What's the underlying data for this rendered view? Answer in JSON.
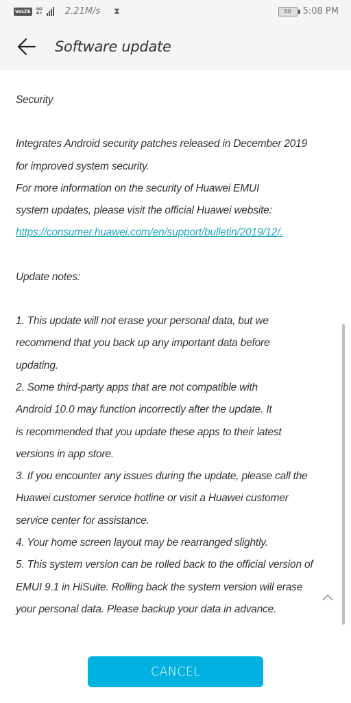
{
  "status_bar": {
    "volte": "VoLTE",
    "network_type": "4G",
    "network_sub": "4+",
    "speed": "2.21M/s",
    "battery": "50",
    "time": "5:08 PM",
    "icons": [
      "volte-icon",
      "signal-icon",
      "hourglass-icon",
      "battery-icon"
    ]
  },
  "app_bar": {
    "back_icon": "arrow-left-icon",
    "title": "Software update"
  },
  "content": {
    "security_heading": "Security",
    "security_lines": [
      "Integrates Android security patches released in December 2019",
      "for improved system security.",
      "For more information on the security of Huawei EMUI",
      "system updates, please visit the official Huawei website:"
    ],
    "security_link": "https://consumer.huawei.com/en/support/bulletin/2019/12/.",
    "notes_heading": "Update notes:",
    "notes_lines": [
      "1. This update will not erase your personal data, but we",
      "recommend that you back up any important data before",
      "updating.",
      "2. Some third-party apps that are not compatible with",
      "Android 10.0 may function incorrectly after the update. It",
      "is recommended that you update these apps to their latest",
      "versions in app store.",
      "3. If you encounter any issues during the update, please call the",
      "Huawei customer service hotline or visit a Huawei customer",
      "service center for assistance.",
      "4. Your home screen layout may be rearranged slightly.",
      "5. This system version can be rolled back to the official version of",
      "EMUI 9.1 in HiSuite. Rolling back the system version will erase",
      "your personal data. Please backup your data in advance."
    ],
    "collapse_icon": "chevron-up-icon"
  },
  "footer": {
    "cancel_label": "CANCEL",
    "accent_color": "#00b1e2",
    "link_color": "#26a7c1"
  }
}
